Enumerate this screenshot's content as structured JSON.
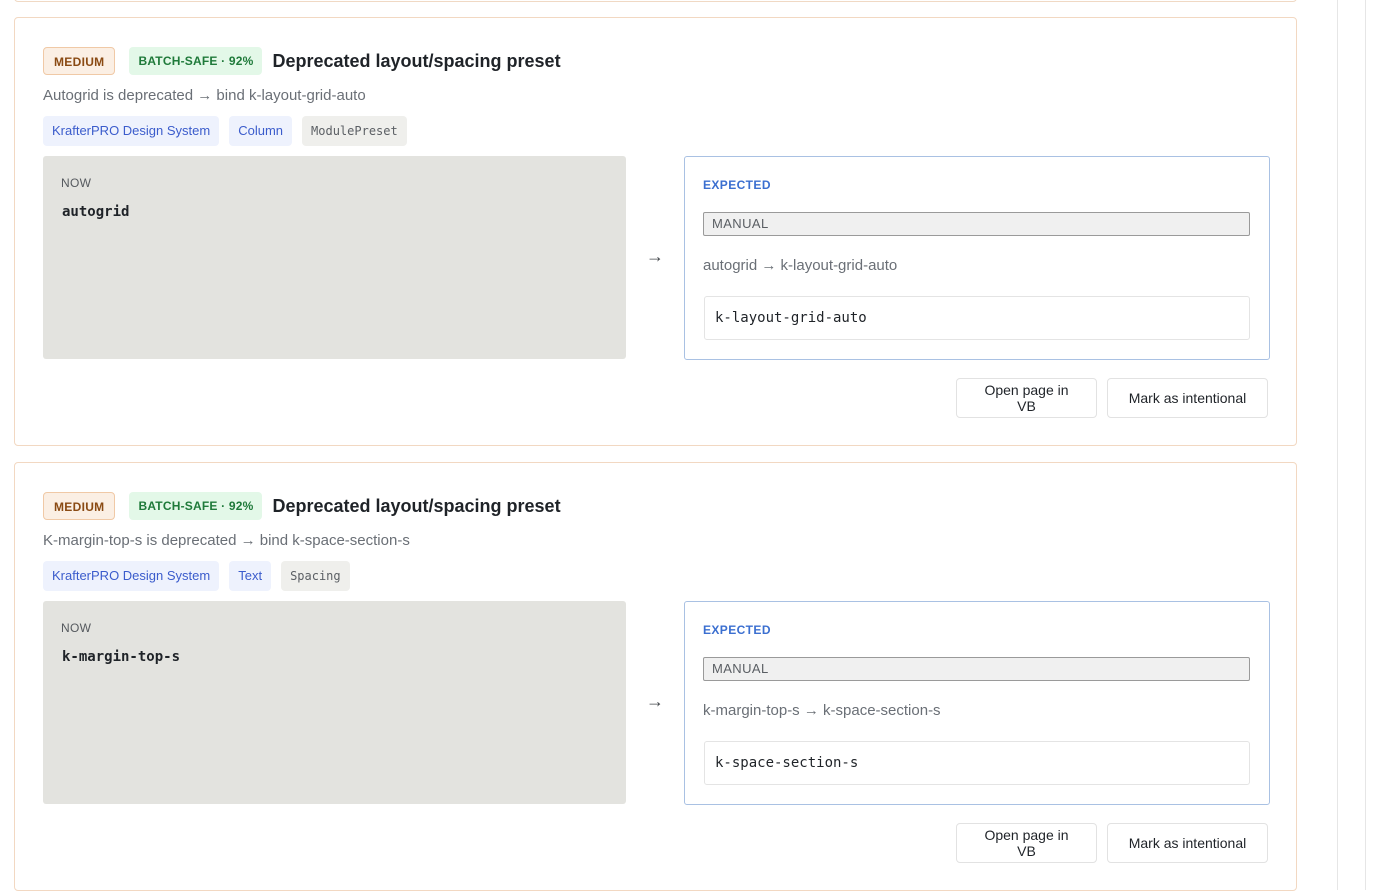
{
  "issues": [
    {
      "severity": "MEDIUM",
      "batch": "BATCH-SAFE · 92%",
      "title": "Deprecated layout/spacing preset",
      "description": "Autogrid is deprecated → bind k-layout-grid-auto",
      "tags": [
        "KrafterPRO Design System",
        "Column",
        "ModulePreset"
      ],
      "now_label": "NOW",
      "now_value": "autogrid",
      "arrow": "→",
      "expected_label": "EXPECTED",
      "mode": "MANUAL",
      "mapping": "autogrid → k-layout-grid-auto",
      "expected_value": "k-layout-grid-auto",
      "open_label": "Open page in VB",
      "mark_label": "Mark as intentional"
    },
    {
      "severity": "MEDIUM",
      "batch": "BATCH-SAFE · 92%",
      "title": "Deprecated layout/spacing preset",
      "description": "K-margin-top-s is deprecated → bind k-space-section-s",
      "tags": [
        "KrafterPRO Design System",
        "Text",
        "Spacing"
      ],
      "now_label": "NOW",
      "now_value": "k-margin-top-s",
      "arrow": "→",
      "expected_label": "EXPECTED",
      "mode": "MANUAL",
      "mapping": "k-margin-top-s → k-space-section-s",
      "expected_value": "k-space-section-s",
      "open_label": "Open page in VB",
      "mark_label": "Mark as intentional"
    }
  ],
  "colors": {
    "severity_medium": "#8a4a13",
    "batch_safe": "#1f7a3a",
    "expected_accent": "#3b6fd0",
    "tag_blue": "#3b5ccc"
  }
}
